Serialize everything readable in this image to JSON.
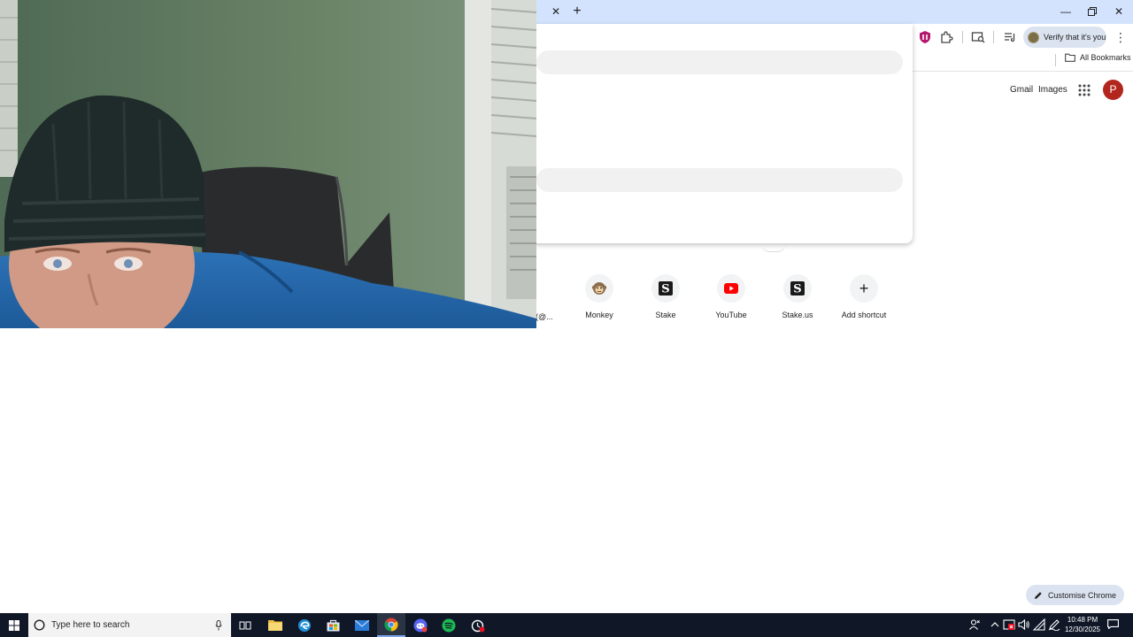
{
  "browser": {
    "verify_chip_label": "Verify that it's you",
    "all_bookmarks_label": "All Bookmarks"
  },
  "google_header": {
    "gmail_label": "Gmail",
    "images_label": "Images",
    "profile_initial": "P"
  },
  "shortcuts": {
    "partial_label": "y (@...",
    "items": [
      {
        "label": "Monkey",
        "icon": "monkey-emoji"
      },
      {
        "label": "Stake",
        "icon": "stake-logo"
      },
      {
        "label": "YouTube",
        "icon": "youtube-logo"
      },
      {
        "label": "Stake.us",
        "icon": "stake-logo"
      },
      {
        "label": "Add shortcut",
        "icon": "plus-icon"
      }
    ]
  },
  "customise_chrome_label": "Customise Chrome",
  "taskbar": {
    "search_placeholder": "Type here to search",
    "time": "10:48 PM",
    "date": "12/30/2025"
  },
  "colors": {
    "tabstrip": "#d3e3fd",
    "profile_avatar": "#b3261e",
    "taskbar": "#101828",
    "youtube_red": "#ff0000"
  }
}
